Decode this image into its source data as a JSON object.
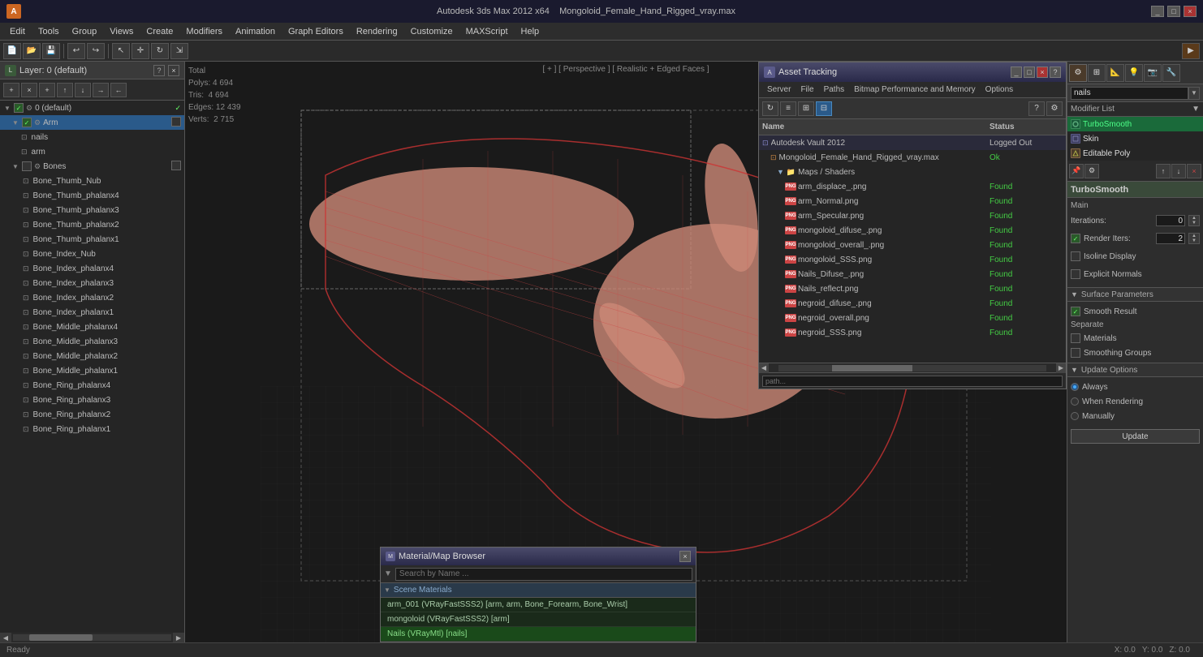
{
  "app": {
    "title": "Autodesk 3ds Max 2012 x64",
    "filename": "Mongoloid_Female_Hand_Rigged_vray.max",
    "window_controls": [
      "_",
      "□",
      "×"
    ]
  },
  "menu": {
    "items": [
      "Edit",
      "Tools",
      "Group",
      "Views",
      "Create",
      "Modifiers",
      "Animation",
      "Graph Editors",
      "Rendering",
      "Customize",
      "MAXScript",
      "Help"
    ]
  },
  "viewport": {
    "label": "[ + ] [ Perspective ] [ Realistic + Edged Faces ]",
    "stats": {
      "polys_label": "Polys:",
      "polys_val": "4 694",
      "tris_label": "Tris:",
      "tris_val": "4 694",
      "edges_label": "Edges:",
      "edges_val": "12 439",
      "verts_label": "Verts:",
      "verts_val": "2 715",
      "total_label": "Total"
    }
  },
  "layers_panel": {
    "title": "Layer: 0 (default)",
    "close": "×",
    "help": "?",
    "toolbar_buttons": [
      "+",
      "×",
      "+",
      "↑",
      "↓",
      "→",
      "←"
    ],
    "items": [
      {
        "id": "layer0",
        "name": "0 (default)",
        "level": 0,
        "has_check": true,
        "checked": true,
        "expand": true
      },
      {
        "id": "arm",
        "name": "Arm",
        "level": 1,
        "has_check": true,
        "selected": true
      },
      {
        "id": "nails",
        "name": "nails",
        "level": 2
      },
      {
        "id": "arm_obj",
        "name": "arm",
        "level": 2
      },
      {
        "id": "bones",
        "name": "Bones",
        "level": 1,
        "has_check": true,
        "expand": true
      },
      {
        "id": "bone1",
        "name": "Bone_Thumb_Nub",
        "level": 2
      },
      {
        "id": "bone2",
        "name": "Bone_Thumb_phalanx4",
        "level": 2
      },
      {
        "id": "bone3",
        "name": "Bone_Thumb_phalanx3",
        "level": 2
      },
      {
        "id": "bone4",
        "name": "Bone_Thumb_phalanx2",
        "level": 2
      },
      {
        "id": "bone5",
        "name": "Bone_Thumb_phalanx1",
        "level": 2
      },
      {
        "id": "bone6",
        "name": "Bone_Index_Nub",
        "level": 2
      },
      {
        "id": "bone7",
        "name": "Bone_Index_phalanx4",
        "level": 2
      },
      {
        "id": "bone8",
        "name": "Bone_Index_phalanx3",
        "level": 2
      },
      {
        "id": "bone9",
        "name": "Bone_Index_phalanx2",
        "level": 2
      },
      {
        "id": "bone10",
        "name": "Bone_Index_phalanx1",
        "level": 2
      },
      {
        "id": "bone11",
        "name": "Bone_Middle_phalanx4",
        "level": 2
      },
      {
        "id": "bone12",
        "name": "Bone_Middle_phalanx3",
        "level": 2
      },
      {
        "id": "bone13",
        "name": "Bone_Middle_phalanx2",
        "level": 2
      },
      {
        "id": "bone14",
        "name": "Bone_Middle_phalanx1",
        "level": 2
      },
      {
        "id": "bone15",
        "name": "Bone_Ring_phalanx4",
        "level": 2
      },
      {
        "id": "bone16",
        "name": "Bone_Ring_phalanx3",
        "level": 2
      },
      {
        "id": "bone17",
        "name": "Bone_Ring_phalanx2",
        "level": 2
      },
      {
        "id": "bone18",
        "name": "Bone_Ring_phalanx1",
        "level": 2
      }
    ]
  },
  "asset_tracking": {
    "title": "Asset Tracking",
    "menu": [
      "Server",
      "File",
      "Paths",
      "Bitmap Performance and Memory",
      "Options"
    ],
    "columns": {
      "name": "Name",
      "status": "Status"
    },
    "rows": [
      {
        "type": "vault",
        "name": "Autodesk Vault 2012",
        "status": "Logged Out",
        "level": 0,
        "icon": "vault"
      },
      {
        "type": "file",
        "name": "Mongoloid_Female_Hand_Rigged_vray.max",
        "status": "Ok",
        "level": 1,
        "icon": "max"
      },
      {
        "type": "group",
        "name": "Maps / Shaders",
        "status": "",
        "level": 2,
        "icon": "folder"
      },
      {
        "type": "png",
        "name": "arm_displace_.png",
        "status": "Found",
        "level": 3,
        "icon": "png"
      },
      {
        "type": "png",
        "name": "arm_Normal.png",
        "status": "Found",
        "level": 3,
        "icon": "png"
      },
      {
        "type": "png",
        "name": "arm_Specular.png",
        "status": "Found",
        "level": 3,
        "icon": "png"
      },
      {
        "type": "png",
        "name": "mongoloid_difuse_.png",
        "status": "Found",
        "level": 3,
        "icon": "png"
      },
      {
        "type": "png",
        "name": "mongoloid_overall_.png",
        "status": "Found",
        "level": 3,
        "icon": "png"
      },
      {
        "type": "png",
        "name": "mongoloid_SSS.png",
        "status": "Found",
        "level": 3,
        "icon": "png"
      },
      {
        "type": "png",
        "name": "Nails_Difuse_.png",
        "status": "Found",
        "level": 3,
        "icon": "png"
      },
      {
        "type": "png",
        "name": "Nails_reflect.png",
        "status": "Found",
        "level": 3,
        "icon": "png"
      },
      {
        "type": "png",
        "name": "negroid_difuse_.png",
        "status": "Found",
        "level": 3,
        "icon": "png"
      },
      {
        "type": "png",
        "name": "negroid_overall.png",
        "status": "Found",
        "level": 3,
        "icon": "png"
      },
      {
        "type": "png",
        "name": "negroid_SSS.png",
        "status": "Found",
        "level": 3,
        "icon": "png"
      }
    ]
  },
  "modifier_panel": {
    "object_name": "nails",
    "modifier_list_label": "Modifier List",
    "modifiers": [
      {
        "name": "TurboSmooth",
        "type": "turbo",
        "selected": true
      },
      {
        "name": "Skin",
        "type": "skin"
      },
      {
        "name": "Editable Poly",
        "type": "edpoly"
      }
    ],
    "turbo_smooth": {
      "header": "TurboSmooth",
      "main_label": "Main",
      "iterations_label": "Iterations:",
      "iterations_value": "0",
      "render_iters_label": "Render Iters:",
      "render_iters_value": "2",
      "render_iters_checked": true,
      "isoline_display_label": "Isoline Display",
      "isoline_checked": false,
      "explicit_normals_label": "Explicit Normals",
      "explicit_checked": false
    },
    "surface_params": {
      "header": "Surface Parameters",
      "smooth_result_label": "Smooth Result",
      "smooth_checked": true,
      "separate_label": "Separate",
      "materials_label": "Materials",
      "materials_checked": false,
      "smoothing_groups_label": "Smoothing Groups",
      "smoothing_checked": false
    },
    "update_options": {
      "header": "Update Options",
      "always_label": "Always",
      "when_rendering_label": "When Rendering",
      "manually_label": "Manually",
      "selected": "always",
      "update_btn": "Update"
    }
  },
  "material_browser": {
    "title": "Material/Map Browser",
    "search_placeholder": "Search by Name ...",
    "section_label": "Scene Materials",
    "items": [
      {
        "name": "arm_001 (VRayFastSSS2) [arm, arm, Bone_Forearm, Bone_Wrist]"
      },
      {
        "name": "mongoloid (VRayFastSSS2) [arm]"
      },
      {
        "name": "Nails (VRayMtl) [nails]",
        "selected": true
      }
    ]
  }
}
